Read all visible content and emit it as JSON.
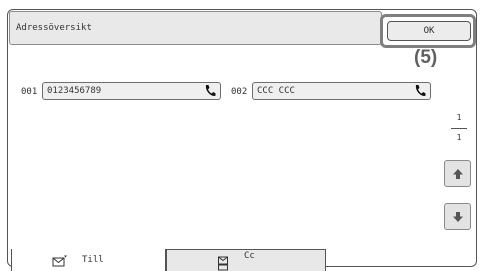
{
  "header": {
    "title": "Adressöversikt",
    "ok_label": "OK",
    "callout": "(5)"
  },
  "entries": [
    {
      "number": "001",
      "name": "0123456789",
      "icon": "phone-icon"
    },
    {
      "number": "002",
      "name": "CCC CCC",
      "icon": "phone-icon"
    }
  ],
  "pagination": {
    "current": "1",
    "total": "1"
  },
  "scroll": {
    "up_icon": "arrow-up-icon",
    "down_icon": "arrow-down-icon"
  },
  "tabs": [
    {
      "label": "Till",
      "icon": "envelope-icon",
      "selected": true
    },
    {
      "label": "Cc",
      "icon": "cc-icon",
      "selected": false
    }
  ],
  "colors": {
    "panel": "#e9e9e9",
    "border": "#555555",
    "callout": "#606060"
  }
}
